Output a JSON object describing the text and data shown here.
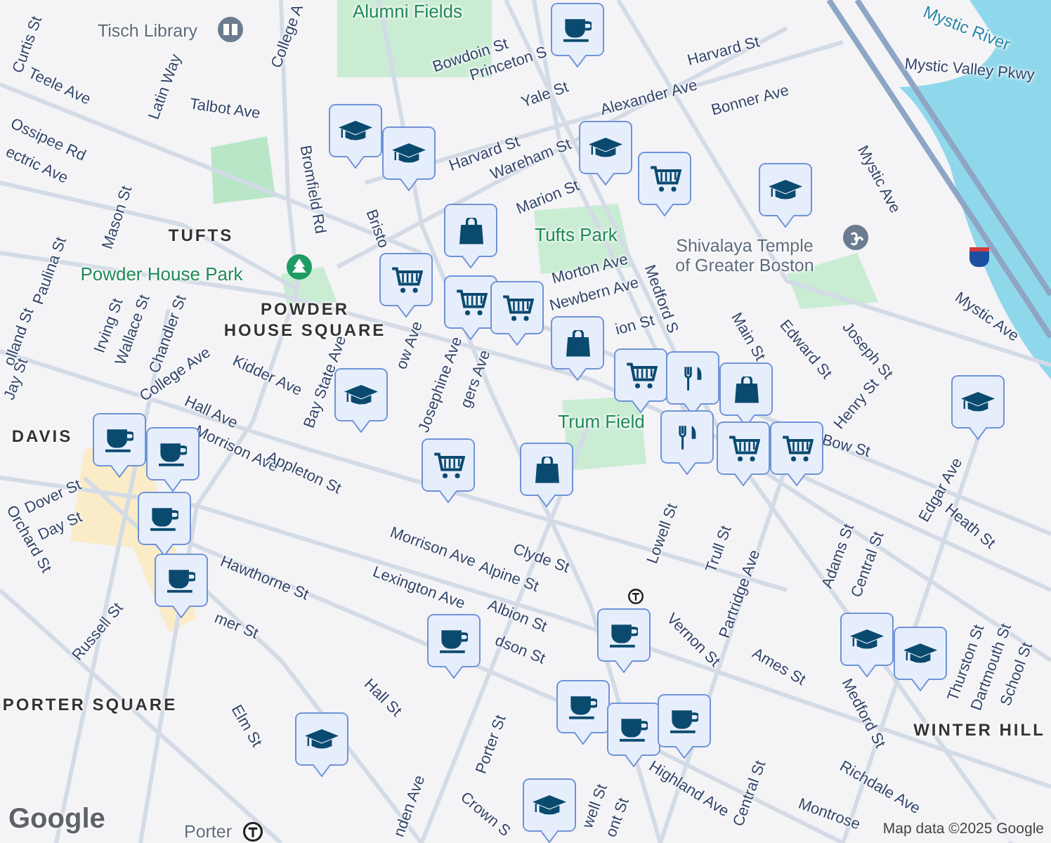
{
  "map": {
    "labels": [
      {
        "kind": "park",
        "text": "Alumni Fields"
      },
      {
        "kind": "poi",
        "text": "Tisch Library"
      },
      {
        "kind": "street",
        "text": "Curtis St"
      },
      {
        "kind": "street",
        "text": "Teele Ave"
      },
      {
        "kind": "street",
        "text": "Latin Way"
      },
      {
        "kind": "street",
        "text": "Talbot Ave"
      },
      {
        "kind": "street",
        "text": "College A"
      },
      {
        "kind": "street",
        "text": "Bowdoin St"
      },
      {
        "kind": "street",
        "text": "Princeton S"
      },
      {
        "kind": "street",
        "text": "Yale St"
      },
      {
        "kind": "street",
        "text": "Harvard St"
      },
      {
        "kind": "street",
        "text": "Harvard St"
      },
      {
        "kind": "street",
        "text": "Alexander Ave"
      },
      {
        "kind": "street",
        "text": "Bonner Ave"
      },
      {
        "kind": "street",
        "text": "Mystic Valley Pkwy"
      },
      {
        "kind": "water",
        "text": "Mystic River"
      },
      {
        "kind": "street",
        "text": "Ossipee Rd"
      },
      {
        "kind": "street",
        "text": "ectric Ave"
      },
      {
        "kind": "street",
        "text": "Bromfield Rd"
      },
      {
        "kind": "street",
        "text": "Wareham St"
      },
      {
        "kind": "street",
        "text": "Marion St"
      },
      {
        "kind": "street",
        "text": "Mason St"
      },
      {
        "kind": "area",
        "text": "TUFTS"
      },
      {
        "kind": "park",
        "text": "Tufts Park"
      },
      {
        "kind": "poi",
        "text": "Shivalaya Temple\nof Greater Boston"
      },
      {
        "kind": "street",
        "text": "Mystic Ave"
      },
      {
        "kind": "street",
        "text": "Mystic Ave"
      },
      {
        "kind": "park",
        "text": "Powder House Park"
      },
      {
        "kind": "area",
        "text": "POWDER\nHOUSE SQUARE"
      },
      {
        "kind": "street",
        "text": "Paulina St"
      },
      {
        "kind": "street",
        "text": "olland St"
      },
      {
        "kind": "street",
        "text": "Jay St"
      },
      {
        "kind": "street",
        "text": "Irving St"
      },
      {
        "kind": "street",
        "text": "Wallace St"
      },
      {
        "kind": "street",
        "text": "Chandler St"
      },
      {
        "kind": "street",
        "text": "College Ave"
      },
      {
        "kind": "street",
        "text": "Kidder Ave"
      },
      {
        "kind": "street",
        "text": "Hall Ave"
      },
      {
        "kind": "street",
        "text": "Bay State Ave"
      },
      {
        "kind": "street",
        "text": "Bristo"
      },
      {
        "kind": "street",
        "text": "ow Ave"
      },
      {
        "kind": "street",
        "text": "Josephine Ave"
      },
      {
        "kind": "street",
        "text": "gers Ave"
      },
      {
        "kind": "street",
        "text": "Morton Ave"
      },
      {
        "kind": "street",
        "text": "Newbern Ave"
      },
      {
        "kind": "street",
        "text": "ion St"
      },
      {
        "kind": "street",
        "text": "Medford S"
      },
      {
        "kind": "street",
        "text": "Main St"
      },
      {
        "kind": "street",
        "text": "Edward St"
      },
      {
        "kind": "street",
        "text": "Joseph St"
      },
      {
        "kind": "street",
        "text": "Henry St"
      },
      {
        "kind": "street",
        "text": "Bow St"
      },
      {
        "kind": "park",
        "text": "Trum Field"
      },
      {
        "kind": "area",
        "text": "DAVIS"
      },
      {
        "kind": "street",
        "text": "Morrison Ave"
      },
      {
        "kind": "street",
        "text": "Appleton St"
      },
      {
        "kind": "street",
        "text": "Dover St"
      },
      {
        "kind": "street",
        "text": "Day St"
      },
      {
        "kind": "street",
        "text": "Orchard St"
      },
      {
        "kind": "street",
        "text": "Morrison Ave"
      },
      {
        "kind": "street",
        "text": "Clyde St"
      },
      {
        "kind": "street",
        "text": "Lexington Ave"
      },
      {
        "kind": "street",
        "text": "Alpine St"
      },
      {
        "kind": "street",
        "text": "Albion St"
      },
      {
        "kind": "street",
        "text": "dson St"
      },
      {
        "kind": "street",
        "text": "Hawthorne St"
      },
      {
        "kind": "street",
        "text": "mer St"
      },
      {
        "kind": "street",
        "text": "Russell St"
      },
      {
        "kind": "area",
        "text": "PORTER SQUARE"
      },
      {
        "kind": "street",
        "text": "Elm St"
      },
      {
        "kind": "street",
        "text": "Hall St"
      },
      {
        "kind": "street",
        "text": "Porter St"
      },
      {
        "kind": "street",
        "text": "Crown S"
      },
      {
        "kind": "street",
        "text": "nden Ave"
      },
      {
        "kind": "poi",
        "text": "Porter"
      },
      {
        "kind": "street",
        "text": "Highland Ave"
      },
      {
        "kind": "street",
        "text": "well St"
      },
      {
        "kind": "street",
        "text": "ont St"
      },
      {
        "kind": "street",
        "text": "Lowell St"
      },
      {
        "kind": "street",
        "text": "Trull St"
      },
      {
        "kind": "street",
        "text": "Partridge Ave"
      },
      {
        "kind": "street",
        "text": "Vernon St"
      },
      {
        "kind": "street",
        "text": "Adams St"
      },
      {
        "kind": "street",
        "text": "Central St"
      },
      {
        "kind": "street",
        "text": "Ames St"
      },
      {
        "kind": "street",
        "text": "Medford St"
      },
      {
        "kind": "street",
        "text": "Edgar Ave"
      },
      {
        "kind": "street",
        "text": "Heath St"
      },
      {
        "kind": "street",
        "text": "Thurston St"
      },
      {
        "kind": "street",
        "text": "Dartmouth St"
      },
      {
        "kind": "street",
        "text": "School St"
      },
      {
        "kind": "area",
        "text": "WINTER HILL"
      },
      {
        "kind": "street",
        "text": "Central St"
      },
      {
        "kind": "street",
        "text": "Richdale Ave"
      },
      {
        "kind": "street",
        "text": "Montrose"
      }
    ],
    "markers": [
      {
        "kind": "cafe"
      },
      {
        "kind": "school"
      },
      {
        "kind": "school"
      },
      {
        "kind": "school"
      },
      {
        "kind": "grocery"
      },
      {
        "kind": "school"
      },
      {
        "kind": "shopping"
      },
      {
        "kind": "grocery"
      },
      {
        "kind": "grocery"
      },
      {
        "kind": "grocery"
      },
      {
        "kind": "shopping"
      },
      {
        "kind": "grocery"
      },
      {
        "kind": "restaurant"
      },
      {
        "kind": "restaurant"
      },
      {
        "kind": "shopping"
      },
      {
        "kind": "grocery"
      },
      {
        "kind": "grocery"
      },
      {
        "kind": "school"
      },
      {
        "kind": "school"
      },
      {
        "kind": "cafe"
      },
      {
        "kind": "cafe"
      },
      {
        "kind": "grocery"
      },
      {
        "kind": "shopping"
      },
      {
        "kind": "cafe"
      },
      {
        "kind": "cafe"
      },
      {
        "kind": "cafe"
      },
      {
        "kind": "cafe"
      },
      {
        "kind": "school"
      },
      {
        "kind": "school"
      },
      {
        "kind": "cafe"
      },
      {
        "kind": "cafe"
      },
      {
        "kind": "cafe"
      },
      {
        "kind": "school"
      },
      {
        "kind": "school"
      }
    ],
    "logo": "Google",
    "attribution": "Map data ©2025 Google"
  }
}
